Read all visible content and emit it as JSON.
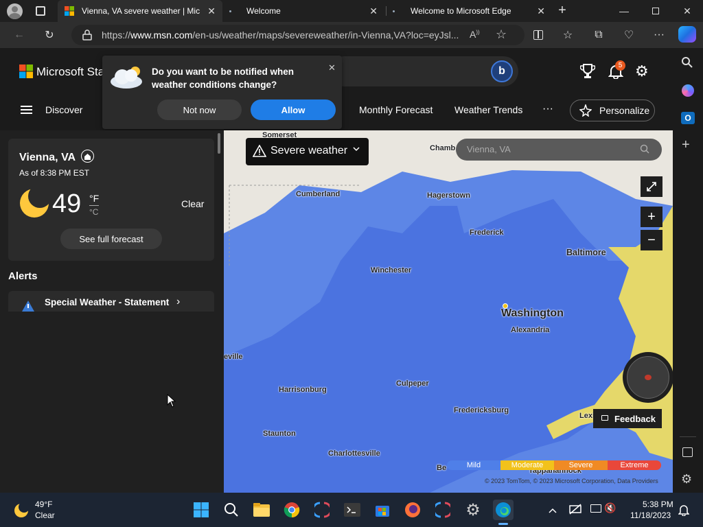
{
  "browser": {
    "tabs": [
      {
        "title": "Vienna, VA severe weather | Mic",
        "active": true
      },
      {
        "title": "Welcome",
        "active": false
      },
      {
        "title": "Welcome to Microsoft Edge",
        "active": false
      }
    ],
    "url_prefix": "https://",
    "url_host": "www.msn.com",
    "url_path": "/en-us/weather/maps/severeweather/in-Vienna,VA?loc=eyJsl..."
  },
  "msn": {
    "brand": "Microsoft Sta",
    "notification_count": "5",
    "nav": {
      "discover": "Discover",
      "monthly": "Monthly Forecast",
      "trends": "Weather Trends",
      "more": "···",
      "personalize": "Personalize"
    }
  },
  "notify_popup": {
    "message": "Do you want to be notified when weather conditions change?",
    "decline": "Not now",
    "accept": "Allow"
  },
  "weather": {
    "location": "Vienna, VA",
    "as_of": "As of 8:38 PM EST",
    "temp": "49",
    "unit_f": "°F",
    "unit_c": "°C",
    "condition": "Clear",
    "forecast_btn": "See full forecast"
  },
  "alerts": {
    "heading": "Alerts",
    "items": [
      {
        "title": "Special Weather - Statement"
      }
    ]
  },
  "map": {
    "layer_label": "Severe weather",
    "search_placeholder": "Vienna, VA",
    "cities": [
      "Somerset",
      "Chamb",
      "Cumberland",
      "Hagerstown",
      "Frederick",
      "Baltimore",
      "Winchester",
      "Washington",
      "Alexandria",
      "eville",
      "Harrisonburg",
      "Culpeper",
      "Fredericksburg",
      "Staunton",
      "Charlottesville",
      "Lexi",
      "Tappahannock",
      "Be"
    ],
    "legend": [
      {
        "label": "Mild",
        "color": "#4f7fe8"
      },
      {
        "label": "Moderate",
        "color": "#f2c21b"
      },
      {
        "label": "Severe",
        "color": "#f08a24"
      },
      {
        "label": "Extreme",
        "color": "#e9473a"
      }
    ],
    "attribution": "© 2023 TomTom, © 2023 Microsoft Corporation, Data Providers",
    "feedback": "Feedback"
  },
  "taskbar": {
    "weather_temp": "49°F",
    "weather_cond": "Clear",
    "time": "5:38 PM",
    "date": "11/18/2023"
  }
}
